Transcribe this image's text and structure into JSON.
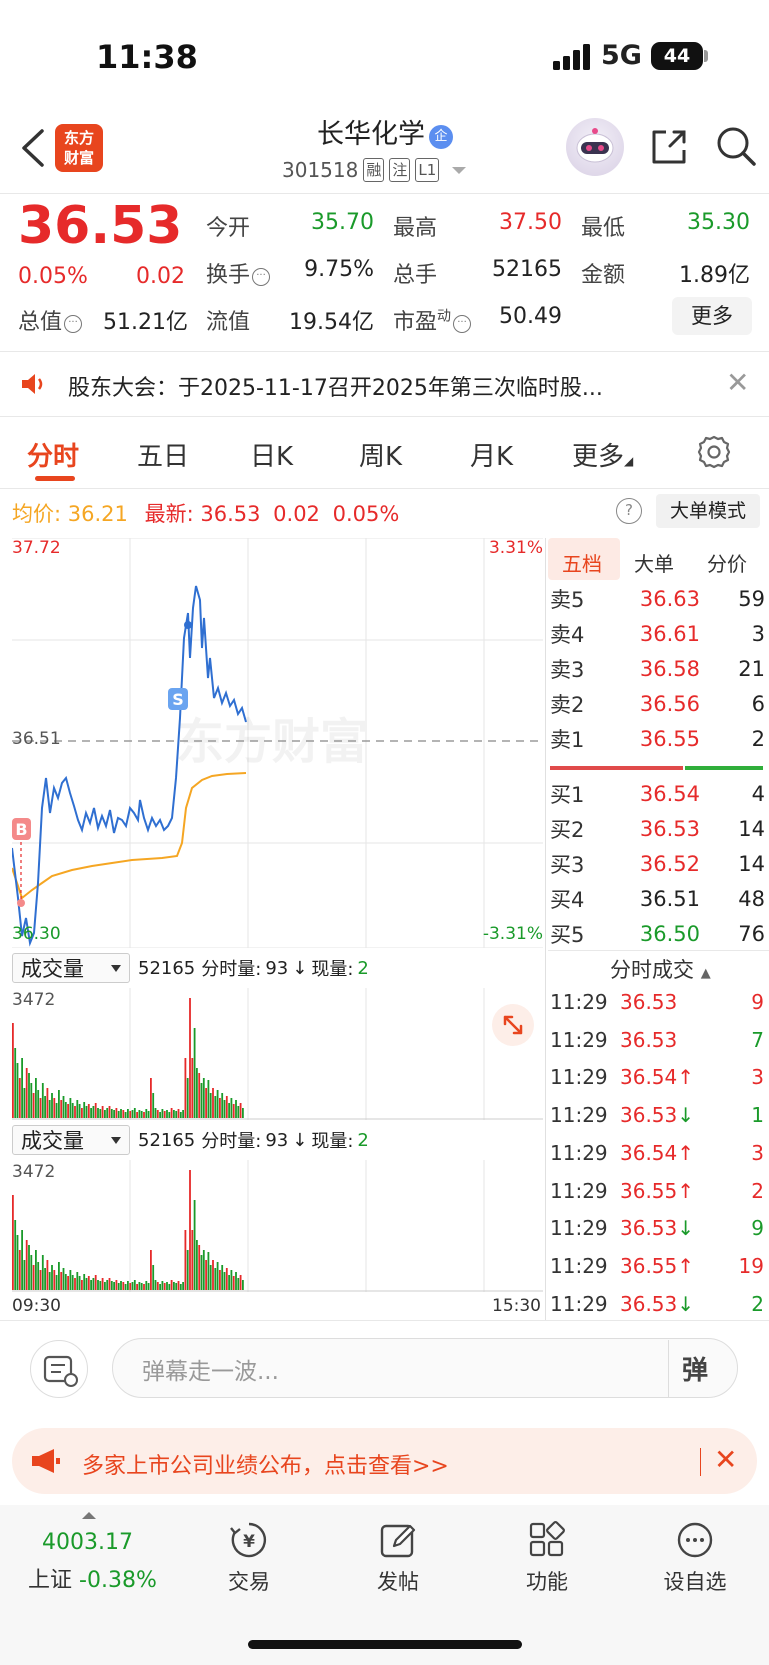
{
  "status_bar": {
    "time": "11:38",
    "network": "5G",
    "battery": "44"
  },
  "header": {
    "logo_line1": "东方",
    "logo_line2": "财富",
    "stock_name": "长华化学",
    "verified_badge": "企",
    "stock_code": "301518",
    "tags": [
      "融",
      "注",
      "L1"
    ]
  },
  "quote": {
    "price": "36.53",
    "change_pct": "0.05%",
    "change": "0.02",
    "stats": [
      {
        "label": "今开",
        "value": "35.70",
        "color": "green"
      },
      {
        "label": "最高",
        "value": "37.50",
        "color": "red"
      },
      {
        "label": "最低",
        "value": "35.30",
        "color": "green"
      },
      {
        "label": "换手",
        "value": "9.75%",
        "color": "black"
      },
      {
        "label": "总手",
        "value": "52165",
        "color": "black"
      },
      {
        "label": "金额",
        "value": "1.89亿",
        "color": "black"
      },
      {
        "label": "总值",
        "value": "51.21亿",
        "color": "black"
      },
      {
        "label": "流值",
        "value": "19.54亿",
        "color": "black"
      },
      {
        "label": "市盈",
        "label_sup": "动",
        "value": "50.49",
        "color": "black"
      }
    ],
    "more_button": "更多"
  },
  "notice": {
    "text": "股东大会：于2025-11-17召开2025年第三次临时股..."
  },
  "tabs": [
    "分时",
    "五日",
    "日K",
    "周K",
    "月K",
    "更多"
  ],
  "avg_row": {
    "avg_label": "均价:",
    "avg_value": "36.21",
    "latest_label": "最新:",
    "latest_value": "36.53",
    "latest_change": "0.02",
    "latest_pct": "0.05%",
    "help_icon_text": "?",
    "mode_button": "大单模式"
  },
  "intraday": {
    "y_high": "37.72",
    "y_low": "36.30",
    "y_mid": "36.51",
    "pct_high": "3.31%",
    "pct_low": "-3.31%",
    "buy_marker": "B",
    "sell_marker": "S",
    "watermark": "东方财富",
    "time_start": "09:30",
    "time_end": "15:30"
  },
  "volume_panels": [
    {
      "selector": "成交量",
      "total": "52165",
      "info_label": "分时量:",
      "info_value": "93",
      "arrow": "↓",
      "now_label": "现量:",
      "now_value": "2",
      "max": "3472"
    },
    {
      "selector": "成交量",
      "total": "52165",
      "info_label": "分时量:",
      "info_value": "93",
      "arrow": "↓",
      "now_label": "现量:",
      "now_value": "2",
      "max": "3472"
    }
  ],
  "orderbook": {
    "tabs": [
      "五档",
      "大单",
      "分价"
    ],
    "asks": [
      {
        "label": "卖5",
        "price": "36.63",
        "vol": "59"
      },
      {
        "label": "卖4",
        "price": "36.61",
        "vol": "3"
      },
      {
        "label": "卖3",
        "price": "36.58",
        "vol": "21"
      },
      {
        "label": "卖2",
        "price": "36.56",
        "vol": "6"
      },
      {
        "label": "卖1",
        "price": "36.55",
        "vol": "2"
      }
    ],
    "bids": [
      {
        "label": "买1",
        "price": "36.54",
        "vol": "4"
      },
      {
        "label": "买2",
        "price": "36.53",
        "vol": "14"
      },
      {
        "label": "买3",
        "price": "36.52",
        "vol": "14"
      },
      {
        "label": "买4",
        "price": "36.51",
        "vol": "48"
      },
      {
        "label": "买5",
        "price": "36.50",
        "vol": "76"
      }
    ],
    "ticks_title": "分时成交",
    "ticks": [
      {
        "time": "11:29",
        "price": "36.53",
        "arrow": "",
        "vol": "9",
        "pcolor": "red",
        "vcolor": "red"
      },
      {
        "time": "11:29",
        "price": "36.53",
        "arrow": "",
        "vol": "7",
        "pcolor": "red",
        "vcolor": "green"
      },
      {
        "time": "11:29",
        "price": "36.54",
        "arrow": "↑",
        "vol": "3",
        "pcolor": "red",
        "vcolor": "red"
      },
      {
        "time": "11:29",
        "price": "36.53",
        "arrow": "↓",
        "vol": "1",
        "pcolor": "red",
        "vcolor": "green"
      },
      {
        "time": "11:29",
        "price": "36.54",
        "arrow": "↑",
        "vol": "3",
        "pcolor": "red",
        "vcolor": "red"
      },
      {
        "time": "11:29",
        "price": "36.55",
        "arrow": "↑",
        "vol": "2",
        "pcolor": "red",
        "vcolor": "red"
      },
      {
        "time": "11:29",
        "price": "36.53",
        "arrow": "↓",
        "vol": "9",
        "pcolor": "red",
        "vcolor": "green"
      },
      {
        "time": "11:29",
        "price": "36.55",
        "arrow": "↑",
        "vol": "19",
        "pcolor": "red",
        "vcolor": "red"
      },
      {
        "time": "11:29",
        "price": "36.53",
        "arrow": "↓",
        "vol": "2",
        "pcolor": "red",
        "vcolor": "green"
      }
    ]
  },
  "comment_bar": {
    "placeholder": "弹幕走一波...",
    "danmu_button": "弹"
  },
  "promo": {
    "text": "多家上市公司业绩公布，点击查看>>"
  },
  "bottom_nav": {
    "index_value": "4003.17",
    "index_name": "上证",
    "index_pct": "-0.38%",
    "items": [
      "交易",
      "发帖",
      "功能",
      "设自选"
    ]
  },
  "colors": {
    "up": "#e62a2a",
    "down": "#1a9a2a",
    "brand": "#e8451e",
    "price_line": "#2f6fd1",
    "avg_line": "#f5a623"
  }
}
